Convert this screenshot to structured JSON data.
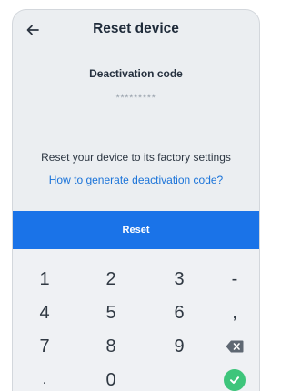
{
  "header": {
    "title": "Reset device",
    "back_icon": "arrow-left-icon"
  },
  "code": {
    "label": "Deactivation code",
    "masked_value": "*********"
  },
  "description": "Reset your device to its factory settings",
  "help_link": "How to generate deactivation code?",
  "reset_button": "Reset",
  "colors": {
    "accent": "#1a73e8",
    "confirm": "#3ec57b",
    "background": "#ebeef1"
  },
  "keypad": {
    "k1": "1",
    "k2": "2",
    "k3": "3",
    "minus": "-",
    "k4": "4",
    "k5": "5",
    "k6": "6",
    "comma": ",",
    "k7": "7",
    "k8": "8",
    "k9": "9",
    "dot": ".",
    "k0": "0",
    "backspace_icon": "backspace-icon",
    "confirm_icon": "check-icon"
  }
}
